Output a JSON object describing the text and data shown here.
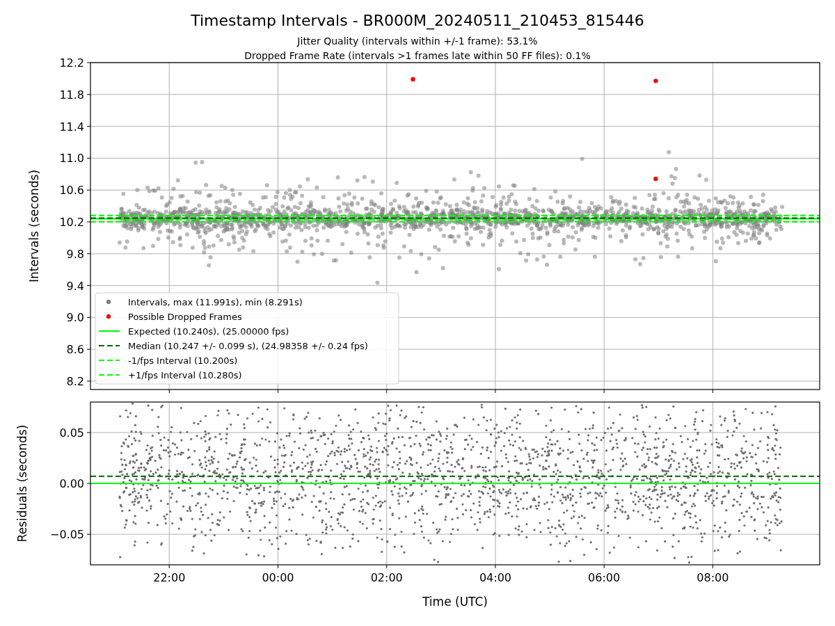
{
  "title": "Timestamp Intervals - BR000M_20240511_210453_815446",
  "subtitles": [
    "Jitter Quality (intervals within +/-1 frame): 53.1%",
    "Dropped Frame Rate (intervals >1 frames late within 50 FF files): 0.1%"
  ],
  "charts": [
    {
      "cloud_legend": {
        "label": "Intervals, max (11.991s), min (8.291s)",
        "color": "#808080"
      },
      "chart_data": {
        "type": "scatter",
        "ylabel": "Intervals (seconds)",
        "xlim": [
          "2024-05-11 20:33",
          "2024-05-12 09:58"
        ],
        "ylim": [
          8.095,
          12.2
        ],
        "yticks": [
          {
            "value": 8.2,
            "label": "8.2"
          },
          {
            "value": 8.6,
            "label": "8.6"
          },
          {
            "value": 9.0,
            "label": "9.0"
          },
          {
            "value": 9.4,
            "label": "9.4"
          },
          {
            "value": 9.8,
            "label": "9.8"
          },
          {
            "value": 10.2,
            "label": "10.2"
          },
          {
            "value": 10.6,
            "label": "10.6"
          },
          {
            "value": 11.0,
            "label": "11.0"
          },
          {
            "value": 11.4,
            "label": "11.4"
          },
          {
            "value": 11.8,
            "label": "11.8"
          },
          {
            "value": 12.2,
            "label": "12.2"
          }
        ],
        "series": [
          {
            "name": "Possible Dropped Frames",
            "color": "#ff0000",
            "x": [
              "2024-05-12 02:29",
              "2024-05-12 06:57",
              "2024-05-12 06:57"
            ],
            "values": [
              11.99,
              11.97,
              10.74
            ]
          },
          {
            "name": "Expected (10.240s), (25.00000 fps)",
            "type": "line",
            "color": "#00ff00",
            "x": [
              "2024-05-11 20:33",
              "2024-05-12 09:58"
            ],
            "values": [
              10.24,
              10.24
            ]
          },
          {
            "name": "Median (10.247 +/- 0.099 s), (24.98358 +/- 0.24 fps)",
            "type": "line",
            "line_style": "dashed",
            "color": "#006400",
            "x": [
              "2024-05-11 20:33",
              "2024-05-12 09:58"
            ],
            "values": [
              10.247,
              10.247
            ]
          },
          {
            "name": "-1/fps Interval (10.200s)",
            "type": "line",
            "line_style": "dashed",
            "color": "#00ff00",
            "x": [
              "2024-05-11 20:33",
              "2024-05-12 09:58"
            ],
            "values": [
              10.2,
              10.2
            ]
          },
          {
            "name": "+1/fps Interval (10.280s)",
            "type": "line",
            "line_style": "dashed",
            "color": "#00ff00",
            "x": [
              "2024-05-11 20:33",
              "2024-05-12 09:58"
            ],
            "values": [
              10.28,
              10.28
            ]
          }
        ],
        "grid": true,
        "legend": "lower left"
      }
    },
    {
      "chart_data": {
        "type": "scatter",
        "xlabel": "Time (UTC)",
        "ylabel": "Residuals (seconds)",
        "xlim": [
          "2024-05-11 20:33",
          "2024-05-12 09:58"
        ],
        "ylim": [
          -0.08,
          0.08
        ],
        "xticks": [
          {
            "value": "2024-05-11 22:00",
            "label": "22:00"
          },
          {
            "value": "2024-05-12 00:00",
            "label": "00:00"
          },
          {
            "value": "2024-05-12 02:00",
            "label": "02:00"
          },
          {
            "value": "2024-05-12 04:00",
            "label": "04:00"
          },
          {
            "value": "2024-05-12 06:00",
            "label": "06:00"
          },
          {
            "value": "2024-05-12 08:00",
            "label": "08:00"
          }
        ],
        "yticks": [
          {
            "value": -0.05,
            "label": "−0.05"
          },
          {
            "value": 0,
            "label": "0.00"
          },
          {
            "value": 0.05,
            "label": "0.05"
          }
        ],
        "series": [
          {
            "type": "line",
            "color": "#00ff00",
            "x": [
              "2024-05-11 20:33",
              "2024-05-12 09:58"
            ],
            "values": [
              0,
              0
            ]
          },
          {
            "type": "line",
            "line_style": "dashed",
            "color": "#006400",
            "x": [
              "2024-05-11 20:33",
              "2024-05-12 09:58"
            ],
            "values": [
              0.007,
              0.007
            ]
          }
        ],
        "grid": true
      }
    }
  ]
}
